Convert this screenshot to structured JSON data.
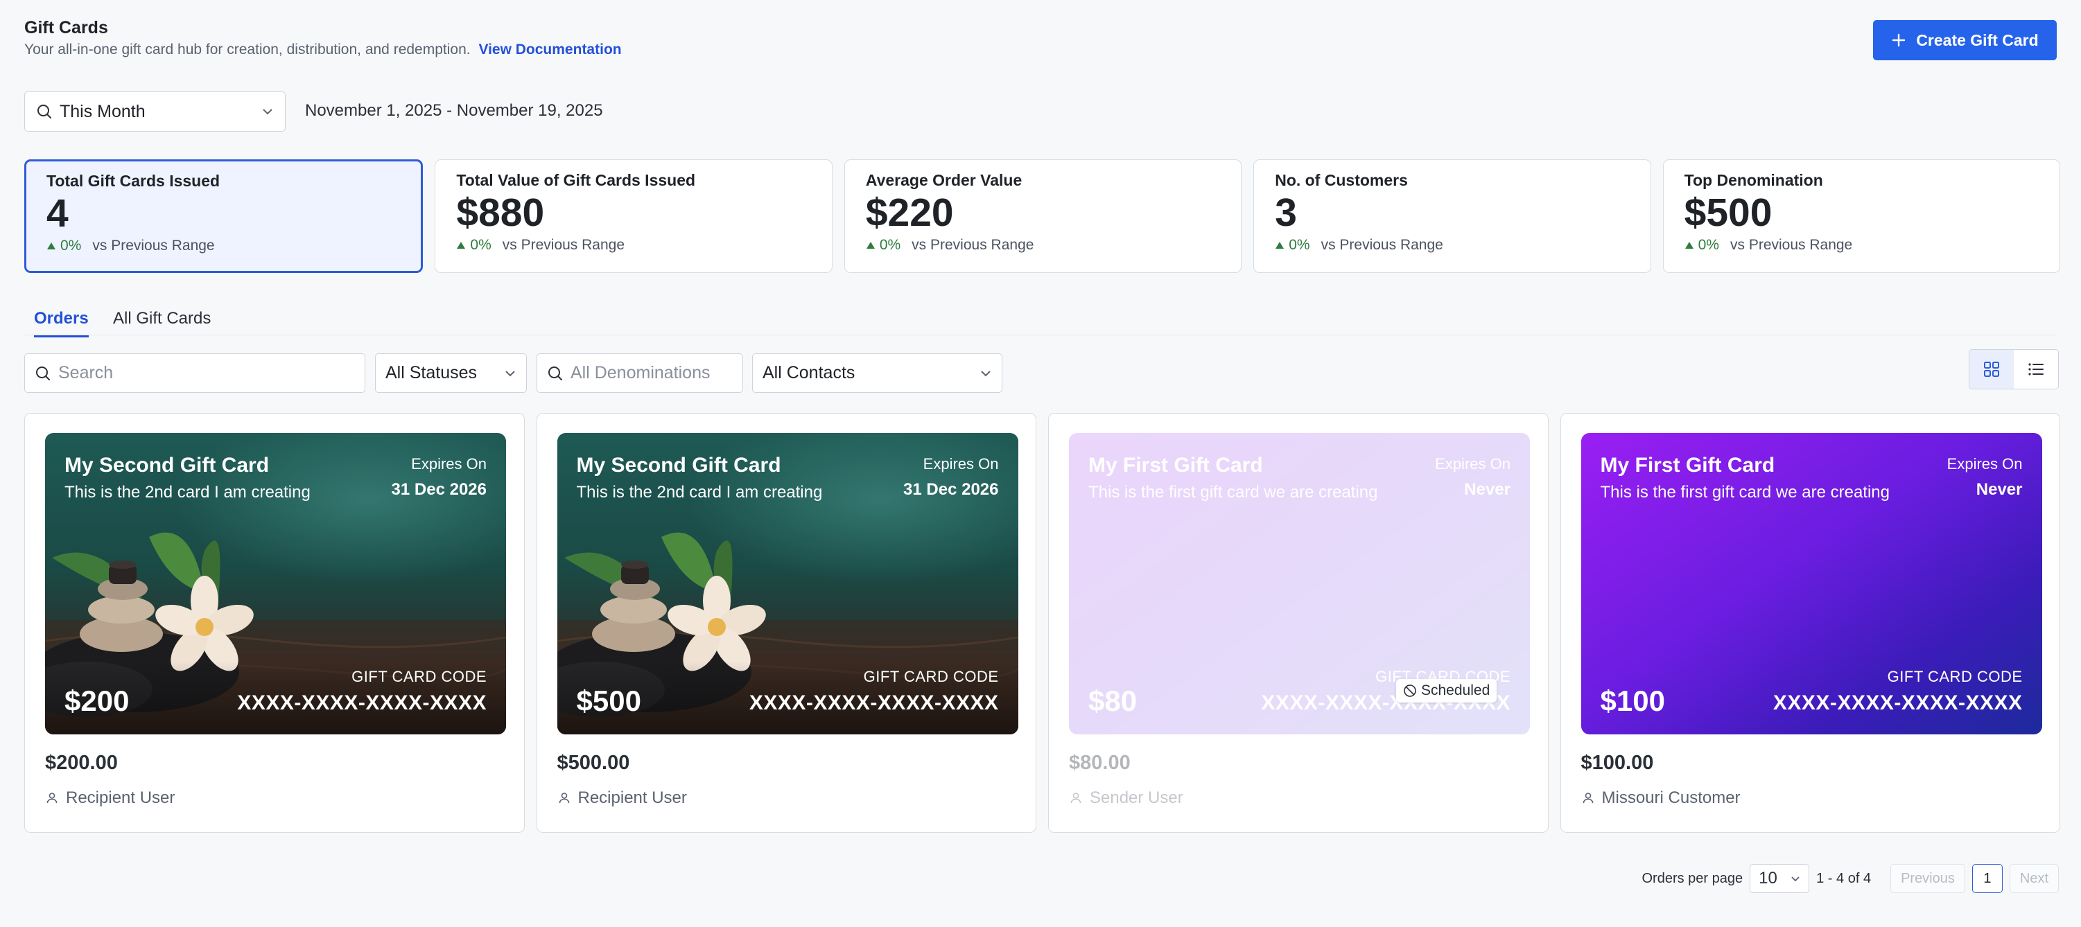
{
  "header": {
    "title": "Gift Cards",
    "subtitle": "Your all-in-one gift card hub for creation, distribution, and redemption.",
    "doc_link": "View Documentation",
    "create_button": "Create Gift Card"
  },
  "range": {
    "selected": "This Month",
    "dates": "November 1, 2025 - November 19, 2025"
  },
  "stats": [
    {
      "label": "Total Gift Cards Issued",
      "value": "4",
      "delta": "0%",
      "compare": "vs Previous Range"
    },
    {
      "label": "Total Value of Gift Cards Issued",
      "value": "$880",
      "delta": "0%",
      "compare": "vs Previous Range"
    },
    {
      "label": "Average Order Value",
      "value": "$220",
      "delta": "0%",
      "compare": "vs Previous Range"
    },
    {
      "label": "No. of Customers",
      "value": "3",
      "delta": "0%",
      "compare": "vs Previous Range"
    },
    {
      "label": "Top Denomination",
      "value": "$500",
      "delta": "0%",
      "compare": "vs Previous Range"
    }
  ],
  "tabs": [
    {
      "label": "Orders"
    },
    {
      "label": "All Gift Cards"
    }
  ],
  "filters": {
    "search_placeholder": "Search",
    "status": "All Statuses",
    "denomination_placeholder": "All Denominations",
    "contacts": "All Contacts"
  },
  "cards": [
    {
      "title": "My Second Gift Card",
      "description": "This is the 2nd card I am creating",
      "expires_label": "Expires On",
      "expires": "31 Dec 2026",
      "code_label": "GIFT CARD CODE",
      "code": "XXXX-XXXX-XXXX-XXXX",
      "amount": "$200",
      "price": "$200.00",
      "user": "Recipient User"
    },
    {
      "title": "My Second Gift Card",
      "description": "This is the 2nd card I am creating",
      "expires_label": "Expires On",
      "expires": "31 Dec 2026",
      "code_label": "GIFT CARD CODE",
      "code": "XXXX-XXXX-XXXX-XXXX",
      "amount": "$500",
      "price": "$500.00",
      "user": "Recipient User"
    },
    {
      "title": "My First Gift Card",
      "description": "This is the first gift card we are creating",
      "expires_label": "Expires On",
      "expires": "Never",
      "code_label": "GIFT CARD CODE",
      "code": "XXXX-XXXX-XXXX-XXXX",
      "amount": "$80",
      "price": "$80.00",
      "user": "Sender User",
      "badge": "Scheduled"
    },
    {
      "title": "My First Gift Card",
      "description": "This is the first gift card we are creating",
      "expires_label": "Expires On",
      "expires": "Never",
      "code_label": "GIFT CARD CODE",
      "code": "XXXX-XXXX-XXXX-XXXX",
      "amount": "$100",
      "price": "$100.00",
      "user": "Missouri Customer"
    }
  ],
  "pagination": {
    "per_page_label": "Orders per page",
    "per_page": "10",
    "range": "1 - 4 of 4",
    "previous": "Previous",
    "page": "1",
    "next": "Next"
  },
  "colors": {
    "accent": "#2563eb",
    "positive": "#2f7d3e",
    "active_stat_bg": "#eef3ff"
  }
}
